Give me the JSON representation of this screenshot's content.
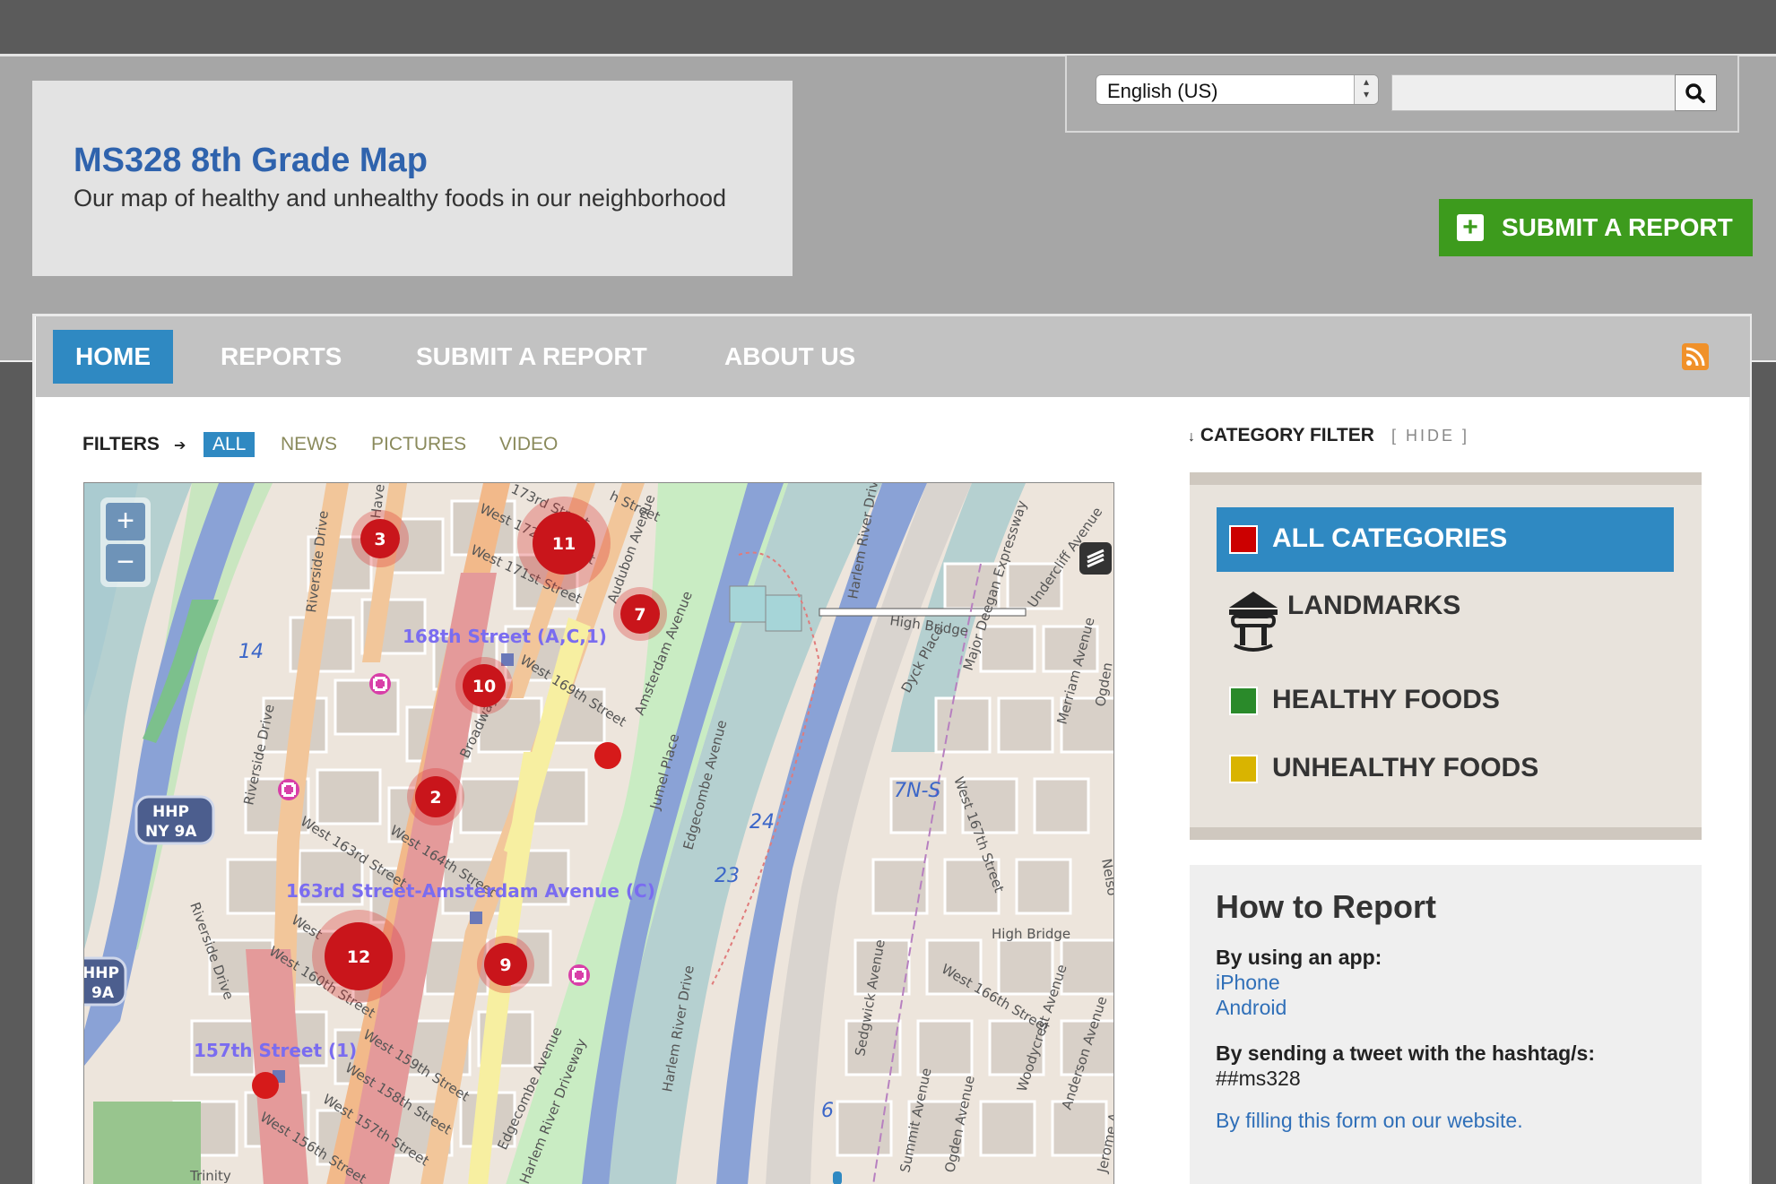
{
  "site": {
    "title": "MS328 8th Grade Map",
    "subtitle": "Our map of healthy and unhealthy foods in our neighborhood"
  },
  "language": {
    "selected": "English (US)"
  },
  "search": {
    "placeholder": ""
  },
  "submit_button": {
    "label": "SUBMIT A REPORT"
  },
  "nav": {
    "items": [
      {
        "label": "HOME",
        "active": true
      },
      {
        "label": "REPORTS",
        "active": false
      },
      {
        "label": "SUBMIT A REPORT",
        "active": false
      },
      {
        "label": "ABOUT US",
        "active": false
      }
    ]
  },
  "filters": {
    "label": "FILTERS",
    "arrow": "➔",
    "options": [
      "ALL",
      "NEWS",
      "PICTURES",
      "VIDEO"
    ],
    "active": "ALL"
  },
  "map": {
    "zoom_in": "+",
    "zoom_out": "−",
    "cluster_markers": [
      "3",
      "11",
      "7",
      "10",
      "2",
      "12",
      "9"
    ],
    "labels": {
      "station_168": "168th Street (A,C,1)",
      "station_163": "163rd Street-Amsterdam Avenue (C)",
      "station_157": "157th Street (1)",
      "hhp_shield": "HHP",
      "ny9a_shield": "NY 9A",
      "hhp_shield_2": "HHP",
      "ny9a_shield_2": "9A",
      "route_14": "14",
      "route_24": "24",
      "route_23": "23",
      "route_6": "6",
      "route_7ns": "7N-S",
      "riverside_drive": "Riverside Drive",
      "riverside_drive_2": "Riverside Drive",
      "riverside_drive_3": "Riverside Drive",
      "broadway": "Broadway",
      "amsterdam_avenue": "Amsterdam Avenue",
      "audubon_avenue": "Audubon Avenue",
      "edgecombe_avenue": "Edgecombe Avenue",
      "edgecombe_avenue_2": "Edgecombe Avenue",
      "jumel_place": "Jumel Place",
      "harlem_river_drive": "Harlem River Drive",
      "harlem_river_drive_2": "Harlem River Drive",
      "harlem_river_driveway": "Harlem River Driveway",
      "major_deegan": "Major Deegan Expressway",
      "sedgwick_avenue": "Sedgwick Avenue",
      "ogden_avenue": "Ogden Avenue",
      "summit_avenue": "Summit Avenue",
      "west_167th": "West 167th Street",
      "west_166th": "West 166th Street",
      "high_bridge": "High Bridge",
      "high_bridge_2": "High Bridge",
      "dyck_place": "Dyck Place",
      "undercliff": "Undercliff Avenue",
      "merriam": "Merriam Avenue",
      "ogden_2": "Ogden",
      "nelson": "Nelso",
      "woodycrest": "Woodycrest Avenue",
      "anderson": "Anderson Avenue",
      "jerome": "Jerome A",
      "west_173rd": "173rd Street",
      "west_172nd": "West 172nd Street",
      "west_171st": "West 171st Street",
      "west_169th": "West 169th Street",
      "west_164th": "West 164th Street",
      "west_163rd": "West 163rd Street",
      "west_160th": "West 160th Street",
      "west_159th": "West 159th Street",
      "west_158th": "West 158th Street",
      "west_157th": "West 157th Street",
      "west_156th": "West 156th Street",
      "street_top": "h Street",
      "haven": "Have",
      "west_top": "West",
      "trinity": "Trinity"
    }
  },
  "category_filter": {
    "heading": "CATEGORY FILTER",
    "heading_arrow": "↓",
    "hide": "[ HIDE ]",
    "items": [
      {
        "label": "ALL CATEGORIES",
        "color": "#cc0000"
      },
      {
        "label": "LANDMARKS",
        "color": ""
      },
      {
        "label": "HEALTHY FOODS",
        "color": "#2a8a2a"
      },
      {
        "label": "UNHEALTHY FOODS",
        "color": "#d9b400"
      }
    ]
  },
  "how_to_report": {
    "title": "How to Report",
    "app_heading": "By using an app:",
    "app_links": [
      "iPhone",
      "Android"
    ],
    "tweet_heading": "By sending a tweet with the hashtag/s:",
    "hashtag": "##ms328",
    "form_link": "By filling this form on our website."
  },
  "colors": {
    "brand_blue": "#2f63ad",
    "nav_active": "#2f89c2",
    "submit_green": "#3d9b1d",
    "marker_red": "#cc1f1f",
    "link_blue": "#2f6fb8",
    "filter_olive": "#8a8a5c"
  }
}
